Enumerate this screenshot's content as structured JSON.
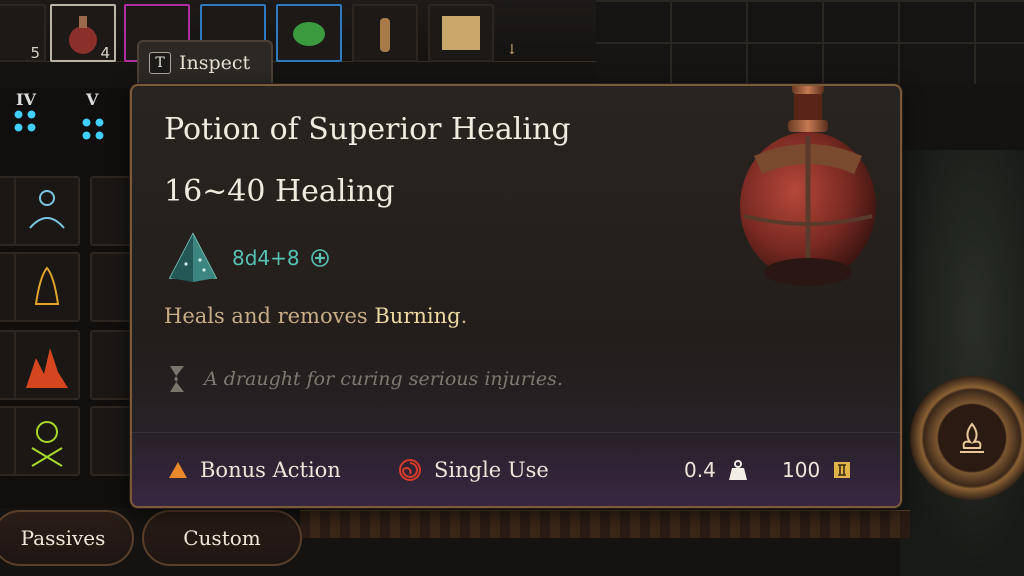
{
  "inspect": {
    "key": "T",
    "label": "Inspect"
  },
  "inventory": {
    "slot_counts": [
      "5",
      "4"
    ]
  },
  "hotbar": {
    "roman_labels": [
      "IV",
      "V"
    ]
  },
  "tooltip": {
    "title": "Potion of Superior Healing",
    "healing": "16~40 Healing",
    "dice_formula": "8d4+8",
    "description_prefix": "Heals and removes ",
    "description_keyword": "Burning",
    "description_suffix": ".",
    "flavor": "A draught for curing serious injuries.",
    "action_type": "Bonus Action",
    "usage": "Single Use",
    "weight": "0.4",
    "value": "100"
  },
  "bottom_tabs": {
    "passives": "Passives",
    "custom": "Custom"
  },
  "colors": {
    "accent_teal": "#56c3b5",
    "keyword_gold": "#efd9a2",
    "description_tan": "#c9ad86",
    "border_bronze": "#7a5a3a"
  },
  "icons": {
    "dice": "d4-dice-icon",
    "plus": "plus-circle-icon",
    "flavor": "scroll-fragment-icon",
    "action": "triangle-bonus-action-icon",
    "usage": "spiral-single-use-icon",
    "weight": "weight-icon",
    "value": "gold-coin-icon",
    "potion": "healing-potion-icon",
    "main_button": "campfire-icon"
  }
}
